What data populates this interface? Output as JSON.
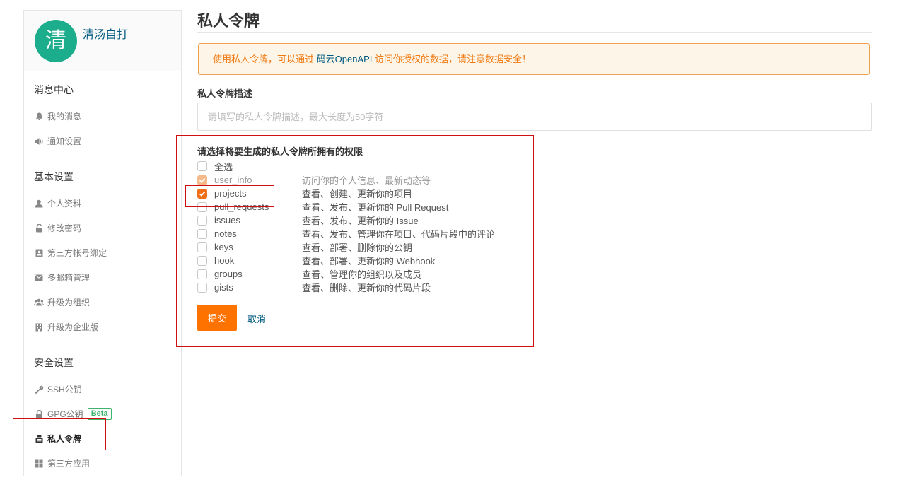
{
  "sidebar": {
    "avatar_char": "清",
    "username": "清汤自打",
    "sections": {
      "messages": {
        "title": "消息中心",
        "items": [
          "我的消息",
          "通知设置"
        ]
      },
      "basic": {
        "title": "基本设置",
        "items": [
          "个人资料",
          "修改密码",
          "第三方帐号绑定",
          "多邮箱管理",
          "升级为组织",
          "升级为企业版"
        ]
      },
      "security": {
        "title": "安全设置",
        "items": [
          "SSH公钥",
          "GPG公钥",
          "私人令牌",
          "第三方应用"
        ],
        "beta_label": "Beta"
      }
    }
  },
  "main": {
    "title": "私人令牌",
    "notice": {
      "prefix": "使用私人令牌，可以通过 ",
      "link": "码云OpenAPI",
      "suffix": " 访问你授权的数据，请注意数据安全！"
    },
    "desc_label": "私人令牌描述",
    "desc_placeholder": "请填写的私人令牌描述，最大长度为50字符",
    "scope_label": "请选择将要生成的私人令牌所拥有的权限",
    "select_all": "全选",
    "scopes": [
      {
        "name": "user_info",
        "desc": "访问你的个人信息、最新动态等"
      },
      {
        "name": "projects",
        "desc": "查看、创建、更新你的项目"
      },
      {
        "name": "pull_requests",
        "desc": "查看、发布、更新你的 Pull Request"
      },
      {
        "name": "issues",
        "desc": "查看、发布、更新你的 Issue"
      },
      {
        "name": "notes",
        "desc": "查看、发布、管理你在项目、代码片段中的评论"
      },
      {
        "name": "keys",
        "desc": "查看、部署、删除你的公钥"
      },
      {
        "name": "hook",
        "desc": "查看、部署、更新你的 Webhook"
      },
      {
        "name": "groups",
        "desc": "查看、管理你的组织以及成员"
      },
      {
        "name": "gists",
        "desc": "查看、删除、更新你的代码片段"
      }
    ],
    "submit_label": "提交",
    "cancel_label": "取消"
  },
  "colors": {
    "accent": "#fe7300",
    "link": "#005980",
    "avatar": "#1cae8c",
    "highlight": "#d01010"
  }
}
